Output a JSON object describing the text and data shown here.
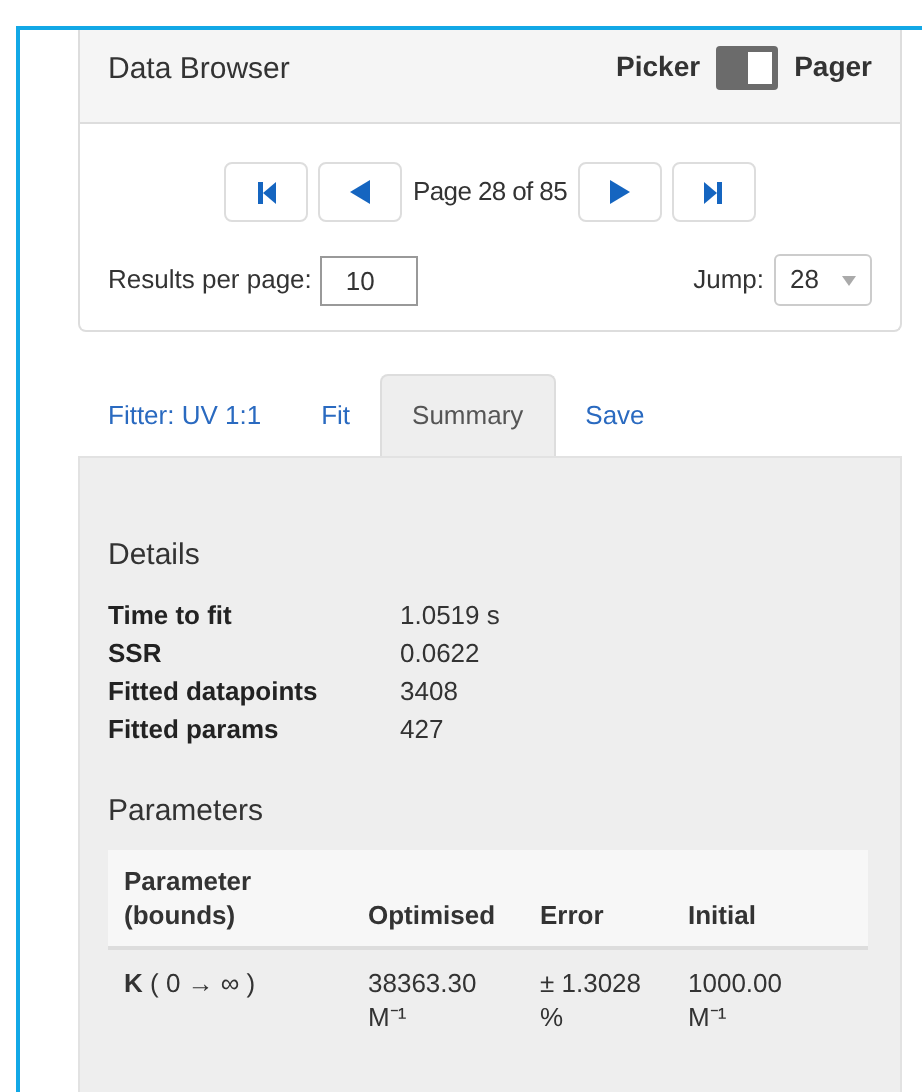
{
  "data_browser": {
    "title": "Data Browser",
    "toggle": {
      "left_label": "Picker",
      "right_label": "Pager",
      "on": true
    },
    "pager": {
      "page_label": "Page 28 of 85",
      "results_label": "Results per page:",
      "results_value": "10",
      "jump_label": "Jump:",
      "jump_value": "28"
    }
  },
  "tabs": [
    {
      "label": "Fitter: UV 1:1",
      "selected": false
    },
    {
      "label": "Fit",
      "selected": false
    },
    {
      "label": "Summary",
      "selected": true
    },
    {
      "label": "Save",
      "selected": false
    }
  ],
  "details": {
    "heading": "Details",
    "rows": [
      {
        "label": "Time to fit",
        "value": "1.0519 s"
      },
      {
        "label": "SSR",
        "value": "0.0622"
      },
      {
        "label": "Fitted datapoints",
        "value": "3408"
      },
      {
        "label": "Fitted params",
        "value": "427"
      }
    ]
  },
  "parameters": {
    "heading": "Parameters",
    "columns": [
      "Parameter (bounds)",
      "Optimised",
      "Error",
      "Initial"
    ],
    "rows": [
      {
        "parameter": "**K** ( 0 → ∞ )",
        "optimised": "38363.30 M⁻¹",
        "error": "± 1.3028 %",
        "initial": "1000.00 M⁻¹"
      }
    ]
  }
}
